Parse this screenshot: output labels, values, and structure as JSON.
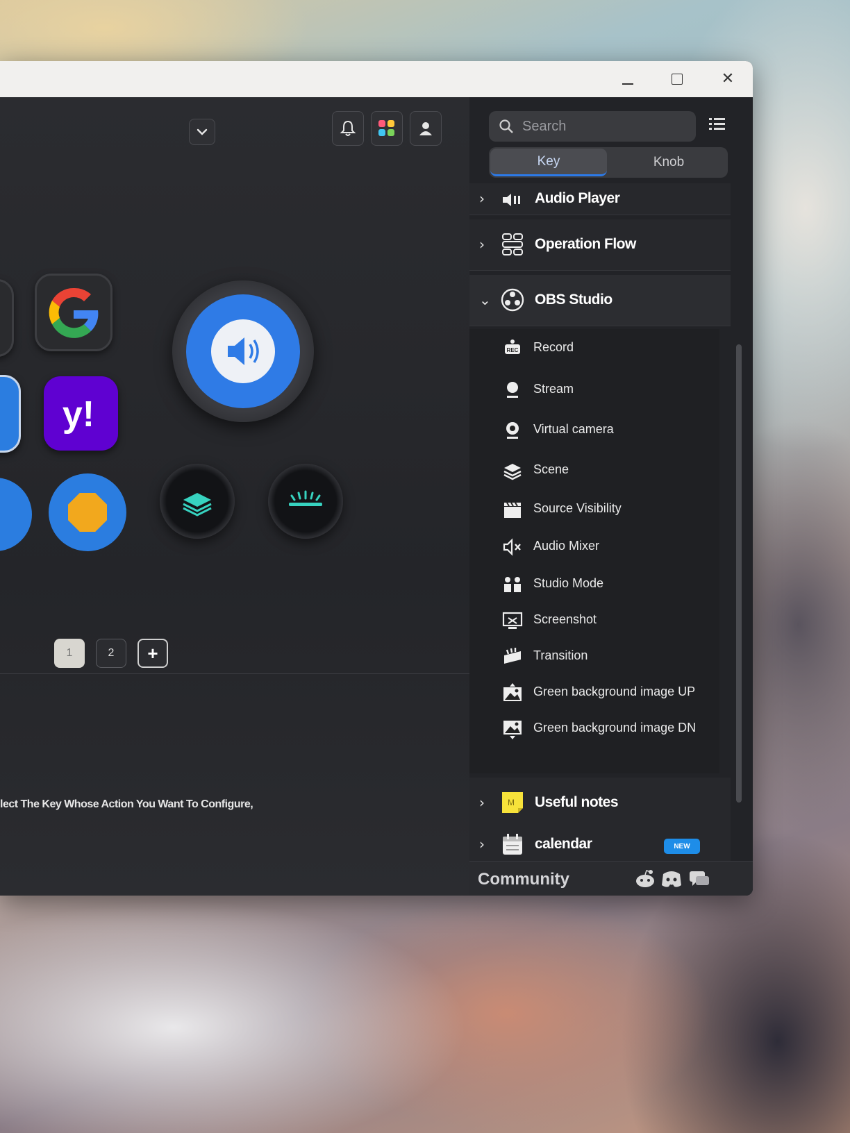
{
  "window": {
    "controls": {
      "minimize": "",
      "maximize": "",
      "close": "✕"
    }
  },
  "toolbar": {
    "dropdown": "",
    "notifications": "",
    "apps": "",
    "account": ""
  },
  "pages": {
    "items": [
      "1",
      "2"
    ],
    "add": "+"
  },
  "hint": "lect The Key Whose Action You Want To Configure,",
  "search": {
    "placeholder": "Search"
  },
  "tabs": {
    "key": "Key",
    "knob": "Knob",
    "active": "Key"
  },
  "categories": {
    "audio_player": "Audio Player",
    "operation_flow": "Operation Flow",
    "obs_studio": "OBS Studio",
    "useful_notes": "Useful notes",
    "calendar": "calendar"
  },
  "obs_actions": [
    "Record",
    "Stream",
    "Virtual camera",
    "Scene",
    "Source Visibility",
    "Audio Mixer",
    "Studio Mode",
    "Screenshot",
    "Transition",
    "Green background image UP",
    "Green background image DN"
  ],
  "badge": "NEW",
  "community": "Community",
  "colors": {
    "accent": "#2c7ae8",
    "badge": "#1e8de8",
    "yahoo": "#5f01d1",
    "sidebar": "#222327"
  }
}
